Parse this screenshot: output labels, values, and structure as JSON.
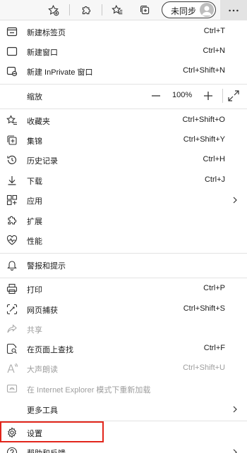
{
  "toolbar": {
    "icons": [
      "add-favorite-icon",
      "extensions-icon",
      "favorites-icon",
      "collections-icon"
    ],
    "sync_label": "未同步",
    "more_icon": "more-icon"
  },
  "menu": {
    "new_tab": {
      "label": "新建标签页",
      "shortcut": "Ctrl+T"
    },
    "new_window": {
      "label": "新建窗口",
      "shortcut": "Ctrl+N"
    },
    "new_inprivate": {
      "label": "新建 InPrivate 窗口",
      "shortcut": "Ctrl+Shift+N"
    },
    "zoom": {
      "label": "缩放",
      "value": "100%",
      "minus": "—",
      "plus": "+"
    },
    "favorites": {
      "label": "收藏夹",
      "shortcut": "Ctrl+Shift+O"
    },
    "collections": {
      "label": "集锦",
      "shortcut": "Ctrl+Shift+Y"
    },
    "history": {
      "label": "历史记录",
      "shortcut": "Ctrl+H"
    },
    "downloads": {
      "label": "下载",
      "shortcut": "Ctrl+J"
    },
    "apps": {
      "label": "应用"
    },
    "extensions": {
      "label": "扩展"
    },
    "performance": {
      "label": "性能"
    },
    "alerts": {
      "label": "警报和提示"
    },
    "print": {
      "label": "打印",
      "shortcut": "Ctrl+P"
    },
    "web_capture": {
      "label": "网页捕获",
      "shortcut": "Ctrl+Shift+S"
    },
    "share": {
      "label": "共享"
    },
    "find": {
      "label": "在页面上查找",
      "shortcut": "Ctrl+F"
    },
    "read_aloud": {
      "label": "大声朗读",
      "shortcut": "Ctrl+Shift+U"
    },
    "ie_mode": {
      "label": "在 Internet Explorer 模式下重新加载"
    },
    "more_tools": {
      "label": "更多工具"
    },
    "settings": {
      "label": "设置"
    },
    "help": {
      "label": "帮助和反馈"
    }
  },
  "colors": {
    "highlight": "#e2251b",
    "disabled_text": "#9e9e9e",
    "text": "#1a1a1a",
    "toolbar_bg": "#f7f7f7",
    "more_button_bg": "#e3e3e3"
  }
}
